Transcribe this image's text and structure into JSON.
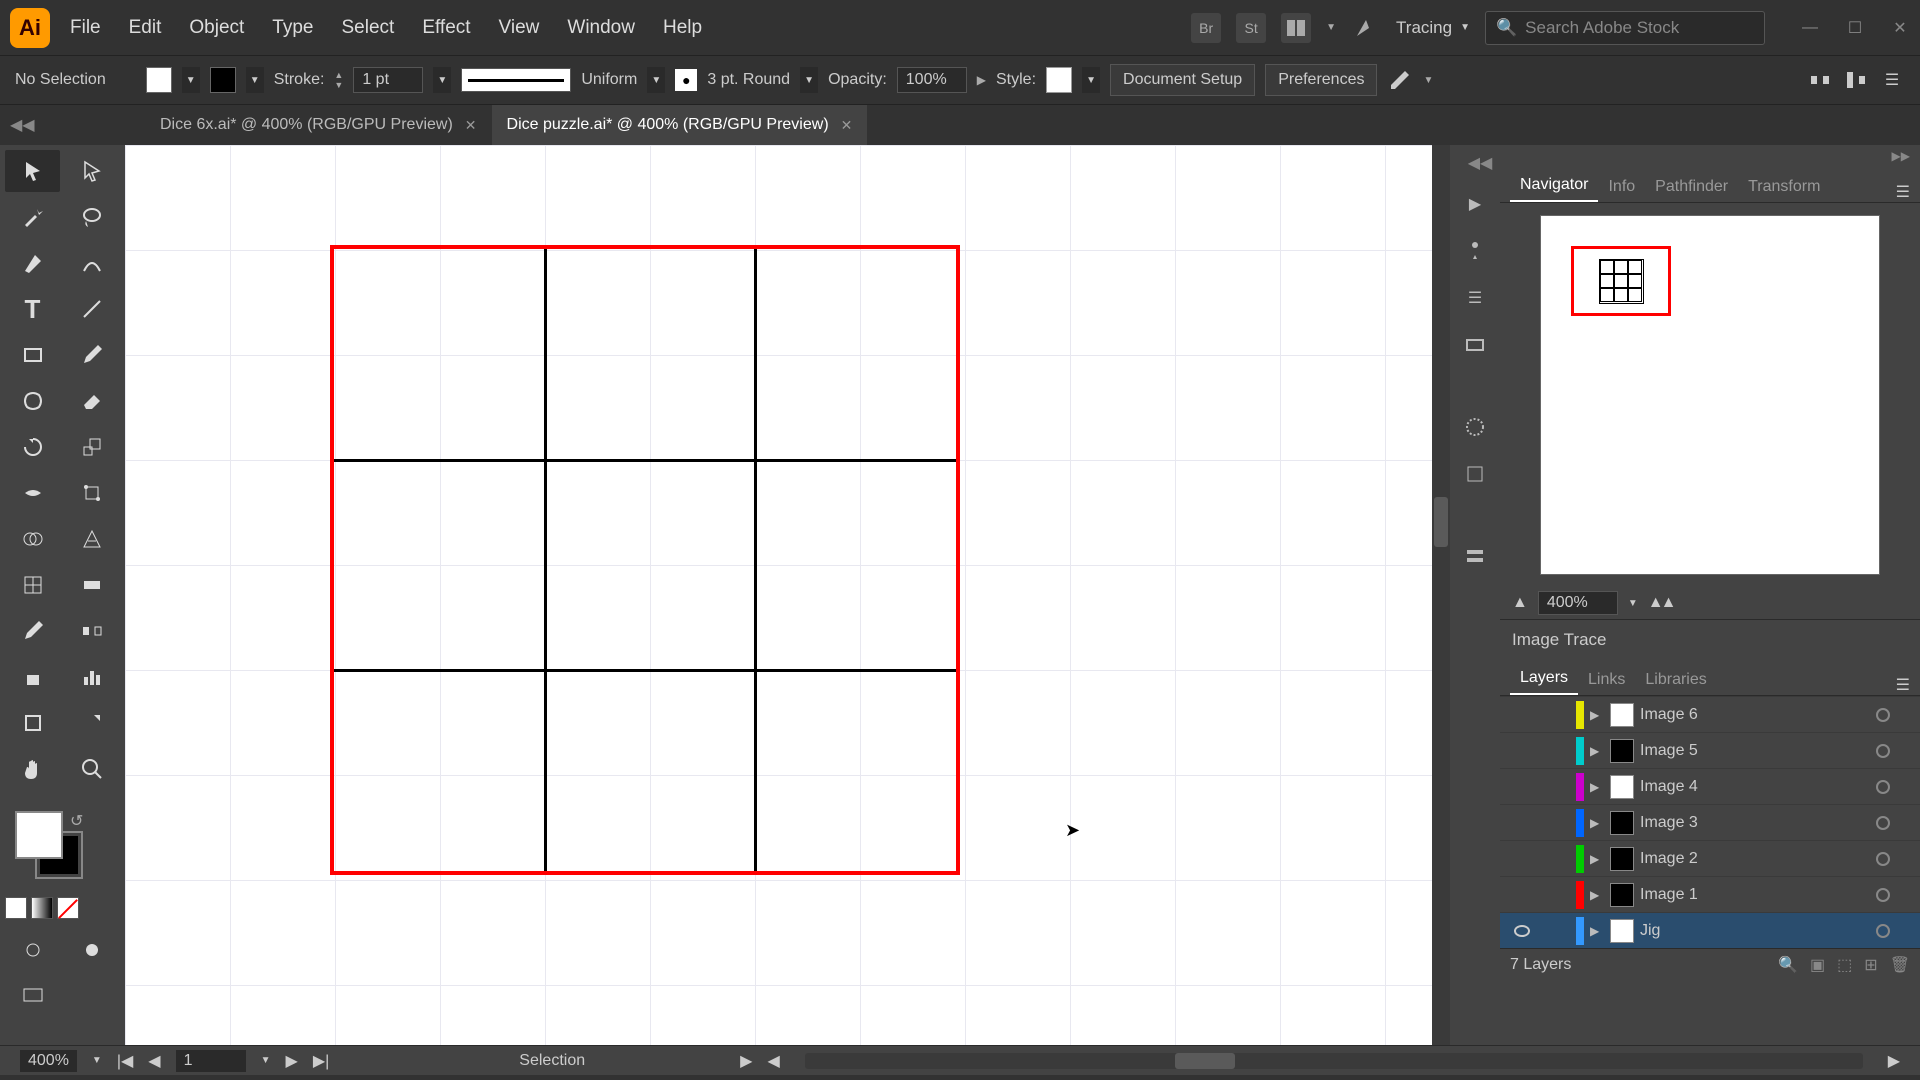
{
  "app": {
    "name": "Adobe Illustrator"
  },
  "menu": [
    "File",
    "Edit",
    "Object",
    "Type",
    "Select",
    "Effect",
    "View",
    "Window",
    "Help"
  ],
  "workspace": {
    "label": "Tracing"
  },
  "search": {
    "placeholder": "Search Adobe Stock"
  },
  "control": {
    "selection": "No Selection",
    "stroke_label": "Stroke:",
    "stroke_weight": "1 pt",
    "profile_label": "Uniform",
    "brush_label": "3 pt. Round",
    "opacity_label": "Opacity:",
    "opacity_value": "100%",
    "style_label": "Style:",
    "doc_setup": "Document Setup",
    "prefs": "Preferences"
  },
  "tabs": [
    {
      "label": "Dice 6x.ai* @ 400% (RGB/GPU Preview)",
      "active": false
    },
    {
      "label": "Dice puzzle.ai* @ 400% (RGB/GPU Preview)",
      "active": true
    }
  ],
  "navigator": {
    "tabs": [
      "Navigator",
      "Info",
      "Pathfinder",
      "Transform"
    ],
    "zoom": "400%"
  },
  "trace": {
    "title": "Image Trace"
  },
  "layers": {
    "tabs": [
      "Layers",
      "Links",
      "Libraries"
    ],
    "items": [
      {
        "name": "Image 6",
        "color": "#e6e600",
        "visible": false,
        "sel": false,
        "dark": false
      },
      {
        "name": "Image 5",
        "color": "#00cccc",
        "visible": false,
        "sel": false,
        "dark": true
      },
      {
        "name": "Image 4",
        "color": "#cc00cc",
        "visible": false,
        "sel": false,
        "dark": false
      },
      {
        "name": "Image 3",
        "color": "#0066ff",
        "visible": false,
        "sel": false,
        "dark": true
      },
      {
        "name": "Image 2",
        "color": "#00cc00",
        "visible": false,
        "sel": false,
        "dark": true
      },
      {
        "name": "Image 1",
        "color": "#ff0000",
        "visible": false,
        "sel": false,
        "dark": true
      },
      {
        "name": "Jig",
        "color": "#3399ff",
        "visible": true,
        "sel": true,
        "dark": false
      }
    ],
    "count": "7 Layers"
  },
  "status": {
    "zoom": "400%",
    "artboard": "1",
    "tool": "Selection"
  }
}
